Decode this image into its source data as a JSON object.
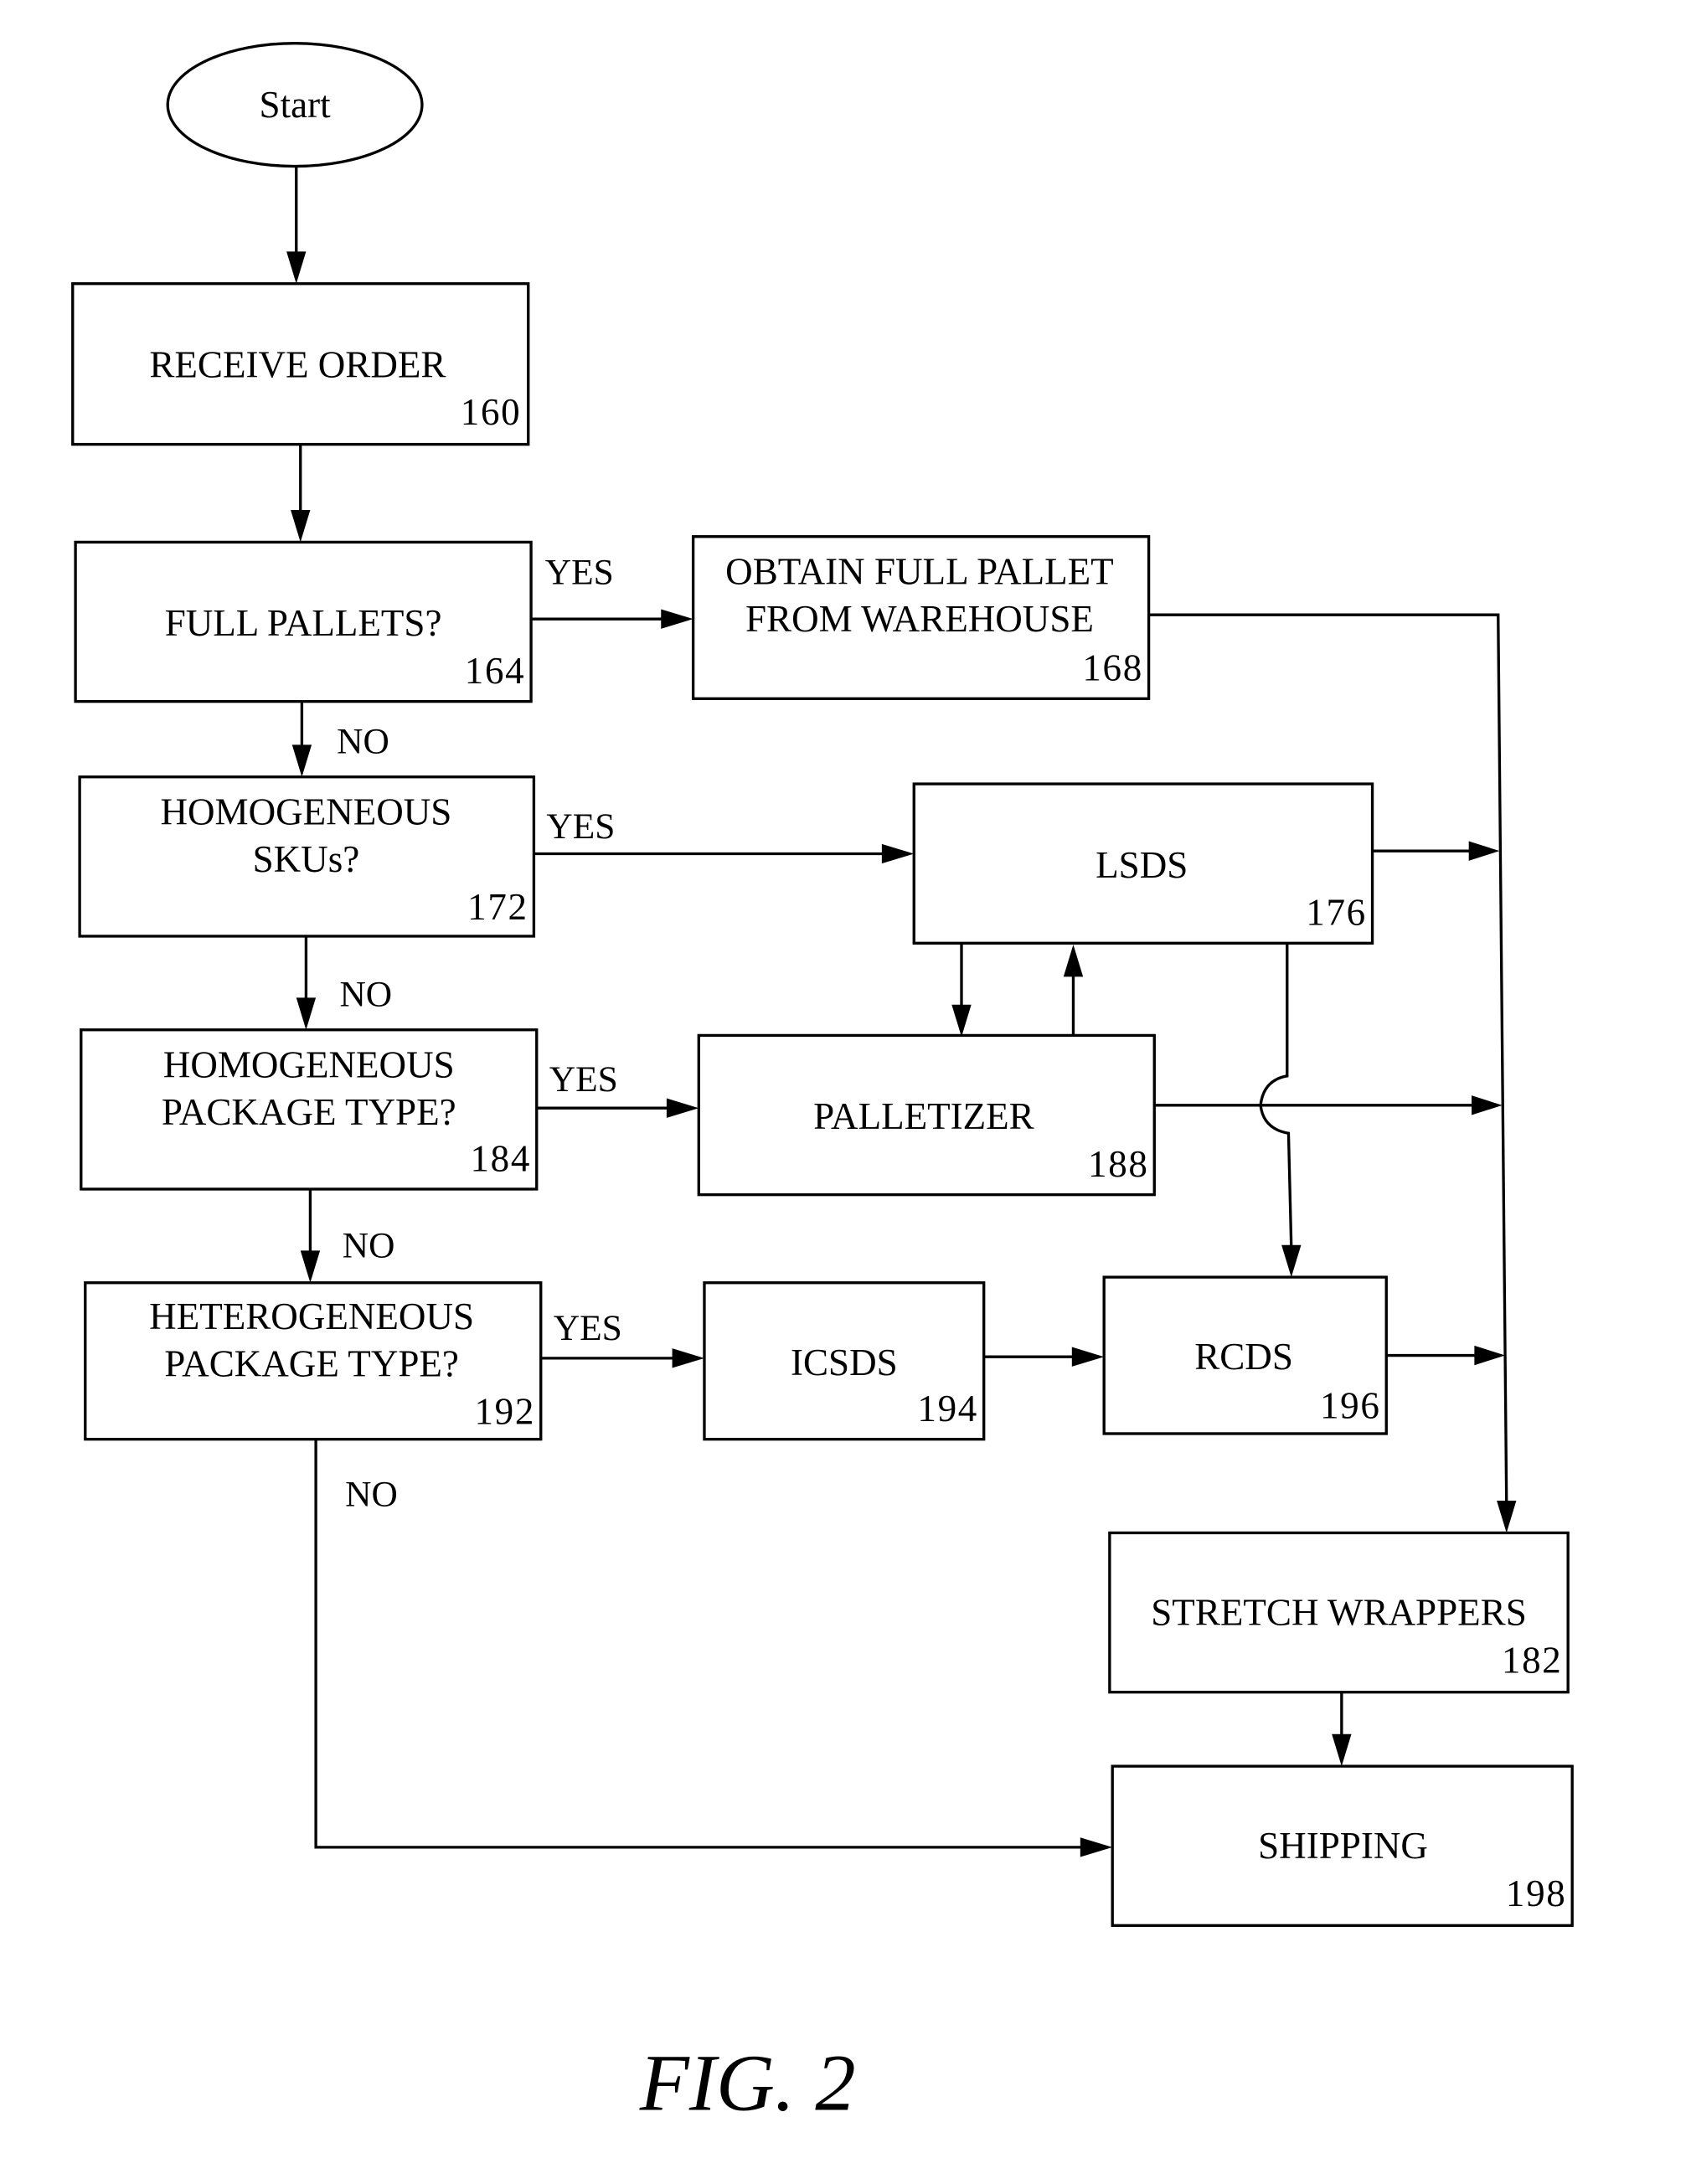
{
  "figure": {
    "caption": "FIG. 2",
    "start": "Start",
    "nodes": {
      "receive_order": {
        "lines": [
          "RECEIVE ORDER"
        ],
        "ref": "160"
      },
      "full_pallets": {
        "lines": [
          "FULL PALLETS?"
        ],
        "ref": "164"
      },
      "obtain_full_pallet": {
        "lines": [
          "OBTAIN FULL PALLET",
          "FROM WAREHOUSE"
        ],
        "ref": "168"
      },
      "homogeneous_skus": {
        "lines": [
          "HOMOGENEOUS",
          "SKUs?"
        ],
        "ref": "172"
      },
      "lsds": {
        "lines": [
          "LSDS"
        ],
        "ref": "176"
      },
      "homogeneous_package": {
        "lines": [
          "HOMOGENEOUS",
          "PACKAGE TYPE?"
        ],
        "ref": "184"
      },
      "palletizer": {
        "lines": [
          "PALLETIZER"
        ],
        "ref": "188"
      },
      "heterogeneous_package": {
        "lines": [
          "HETEROGENEOUS",
          "PACKAGE TYPE?"
        ],
        "ref": "192"
      },
      "icsds": {
        "lines": [
          "ICSDS"
        ],
        "ref": "194"
      },
      "rcds": {
        "lines": [
          "RCDS"
        ],
        "ref": "196"
      },
      "stretch_wrappers": {
        "lines": [
          "STRETCH WRAPPERS"
        ],
        "ref": "182"
      },
      "shipping": {
        "lines": [
          "SHIPPING"
        ],
        "ref": "198"
      }
    },
    "edge_labels": {
      "yes_164": "YES",
      "no_164": "NO",
      "yes_172": "YES",
      "no_172": "NO",
      "yes_184": "YES",
      "no_184": "NO",
      "yes_192": "YES",
      "no_192": "NO"
    },
    "edges": [
      {
        "from": "start",
        "to": "receive_order"
      },
      {
        "from": "receive_order",
        "to": "full_pallets"
      },
      {
        "from": "full_pallets",
        "to": "obtain_full_pallet",
        "label": "YES"
      },
      {
        "from": "full_pallets",
        "to": "homogeneous_skus",
        "label": "NO"
      },
      {
        "from": "homogeneous_skus",
        "to": "lsds",
        "label": "YES"
      },
      {
        "from": "homogeneous_skus",
        "to": "homogeneous_package",
        "label": "NO"
      },
      {
        "from": "homogeneous_package",
        "to": "palletizer",
        "label": "YES"
      },
      {
        "from": "homogeneous_package",
        "to": "heterogeneous_package",
        "label": "NO"
      },
      {
        "from": "heterogeneous_package",
        "to": "icsds",
        "label": "YES"
      },
      {
        "from": "heterogeneous_package",
        "to": "shipping",
        "label": "NO"
      },
      {
        "from": "lsds",
        "to": "palletizer"
      },
      {
        "from": "palletizer",
        "to": "lsds"
      },
      {
        "from": "lsds",
        "to": "rcds"
      },
      {
        "from": "icsds",
        "to": "rcds"
      },
      {
        "from": "obtain_full_pallet",
        "to": "stretch_wrappers"
      },
      {
        "from": "lsds",
        "to": "stretch_wrappers"
      },
      {
        "from": "palletizer",
        "to": "stretch_wrappers"
      },
      {
        "from": "rcds",
        "to": "stretch_wrappers"
      },
      {
        "from": "stretch_wrappers",
        "to": "shipping"
      }
    ]
  }
}
